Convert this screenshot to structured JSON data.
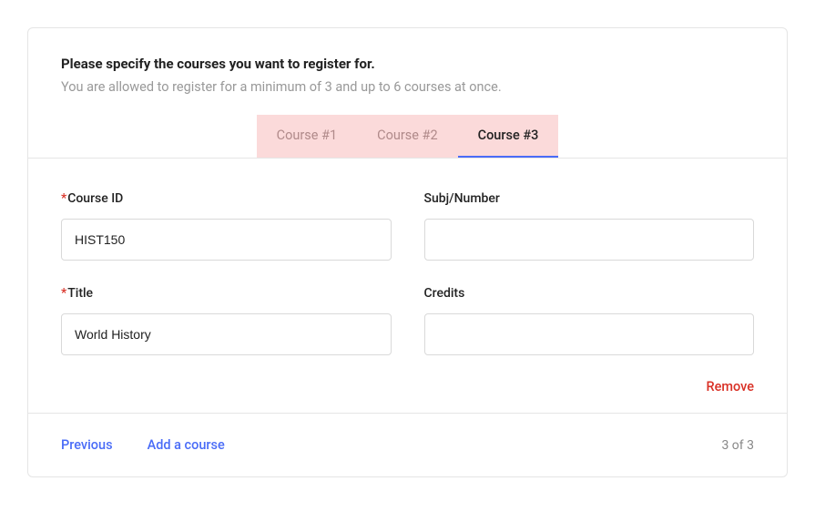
{
  "header": {
    "heading": "Please specify the courses you want to register for.",
    "subheading": "You are allowed to register for a minimum of 3 and up to 6 courses at once."
  },
  "tabs": {
    "items": [
      {
        "label": "Course #1",
        "active": false
      },
      {
        "label": "Course #2",
        "active": false
      },
      {
        "label": "Course #3",
        "active": true
      }
    ]
  },
  "form": {
    "course_id": {
      "label": "Course ID",
      "required": true,
      "value": "HIST150"
    },
    "subj_number": {
      "label": "Subj/Number",
      "required": false,
      "value": ""
    },
    "title": {
      "label": "Title",
      "required": true,
      "value": "World History"
    },
    "credits": {
      "label": "Credits",
      "required": false,
      "value": ""
    },
    "remove_label": "Remove"
  },
  "footer": {
    "previous_label": "Previous",
    "add_label": "Add a course",
    "count_label": "3 of 3"
  }
}
